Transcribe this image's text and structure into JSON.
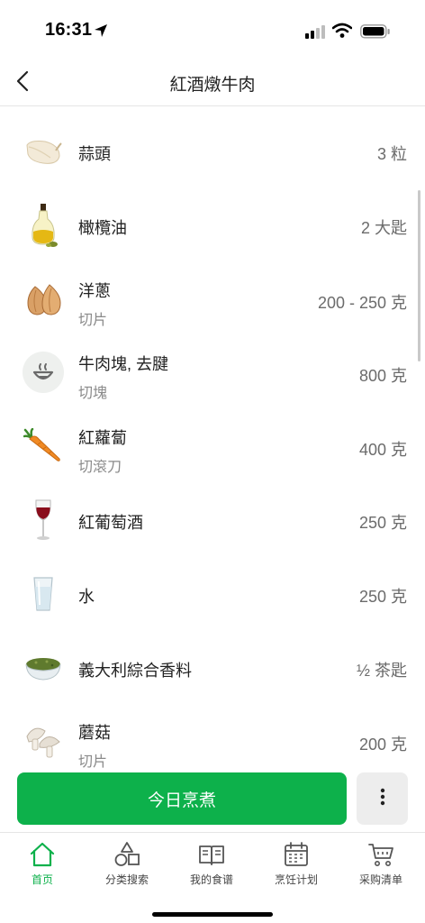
{
  "status": {
    "time": "16:31",
    "icons": [
      "location-arrow-icon",
      "cellular-signal-icon",
      "wifi-icon",
      "battery-icon"
    ]
  },
  "header": {
    "title": "紅酒燉牛肉",
    "back_icon": "chevron-left-icon"
  },
  "ingredients": [
    {
      "name": "蒜頭",
      "note": "",
      "quantity": "3 粒",
      "icon": "garlic-icon"
    },
    {
      "name": "橄欖油",
      "note": "",
      "quantity": "2 大匙",
      "icon": "olive-oil-bottle-icon"
    },
    {
      "name": "洋蔥",
      "note": "切片",
      "quantity": "200 - 250 克",
      "icon": "onion-icon"
    },
    {
      "name": "牛肉塊, 去腱",
      "note": "切塊",
      "quantity": "800 克",
      "icon": "placeholder-bowl-icon"
    },
    {
      "name": "紅蘿蔔",
      "note": "切滾刀",
      "quantity": "400 克",
      "icon": "carrot-icon"
    },
    {
      "name": "紅葡萄酒",
      "note": "",
      "quantity": "250 克",
      "icon": "wine-glass-icon"
    },
    {
      "name": "水",
      "note": "",
      "quantity": "250 克",
      "icon": "water-glass-icon"
    },
    {
      "name": "義大利綜合香料",
      "note": "",
      "quantity": "½ 茶匙",
      "icon": "herbs-bowl-icon"
    },
    {
      "name": "蘑菇",
      "note": "切片",
      "quantity": "200 克",
      "icon": "mushroom-icon"
    }
  ],
  "actions": {
    "cook_label": "今日烹煮",
    "more_icon": "more-vertical-icon"
  },
  "tabs": [
    {
      "label": "首页",
      "icon": "home-icon",
      "active": true
    },
    {
      "label": "分类搜索",
      "icon": "shapes-icon",
      "active": false
    },
    {
      "label": "我的食谱",
      "icon": "book-icon",
      "active": false
    },
    {
      "label": "烹饪计划",
      "icon": "calendar-icon",
      "active": false
    },
    {
      "label": "采购清单",
      "icon": "cart-icon",
      "active": false
    }
  ],
  "colors": {
    "accent": "#0db14b",
    "muted_text": "#8a8a8a",
    "quantity_text": "#6b6b6b"
  }
}
